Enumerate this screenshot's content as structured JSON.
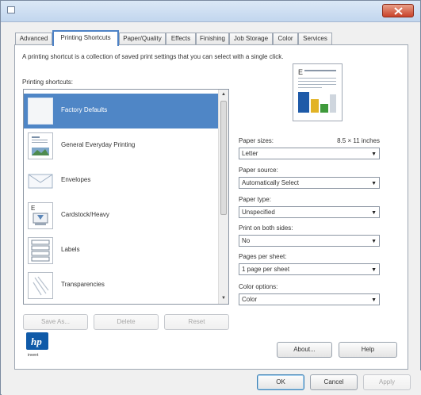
{
  "window": {
    "title": "",
    "close_icon": "close-icon"
  },
  "tabs": [
    {
      "label": "Advanced",
      "active": false
    },
    {
      "label": "Printing Shortcuts",
      "active": true
    },
    {
      "label": "Paper/Quality",
      "active": false
    },
    {
      "label": "Effects",
      "active": false
    },
    {
      "label": "Finishing",
      "active": false
    },
    {
      "label": "Job Storage",
      "active": false
    },
    {
      "label": "Color",
      "active": false
    },
    {
      "label": "Services",
      "active": false
    }
  ],
  "shortcuts_tab": {
    "description": "A printing shortcut is a collection of saved print settings that you can select with a single click.",
    "list_label": "Printing shortcuts:",
    "items": [
      {
        "label": "Factory Defaults",
        "icon": "blank-page-icon",
        "selected": true
      },
      {
        "label": "General Everyday Printing",
        "icon": "photo-page-icon",
        "selected": false
      },
      {
        "label": "Envelopes",
        "icon": "envelope-icon",
        "selected": false
      },
      {
        "label": "Cardstock/Heavy",
        "icon": "cardstock-icon",
        "selected": false
      },
      {
        "label": "Labels",
        "icon": "labels-icon",
        "selected": false
      },
      {
        "label": "Transparencies",
        "icon": "transparency-icon",
        "selected": false
      }
    ],
    "buttons": {
      "save_as": "Save As...",
      "delete": "Delete",
      "reset": "Reset"
    }
  },
  "settings": {
    "paper_sizes": {
      "label": "Paper sizes:",
      "value_text": "8.5 × 11 inches",
      "selected": "Letter"
    },
    "paper_source": {
      "label": "Paper source:",
      "selected": "Automatically Select"
    },
    "paper_type": {
      "label": "Paper type:",
      "selected": "Unspecified"
    },
    "duplex": {
      "label": "Print on both sides:",
      "selected": "No"
    },
    "pages_per_sheet": {
      "label": "Pages per sheet:",
      "selected": "1 page per sheet"
    },
    "color_options": {
      "label": "Color options:",
      "selected": "Color"
    }
  },
  "footer": {
    "logo_text": "invent",
    "about": "About...",
    "help": "Help",
    "ok": "OK",
    "cancel": "Cancel",
    "apply": "Apply"
  },
  "colors": {
    "selection": "#4f86c6",
    "tab_active_border": "#4d82c6",
    "hp_blue": "#0f5aa8"
  }
}
